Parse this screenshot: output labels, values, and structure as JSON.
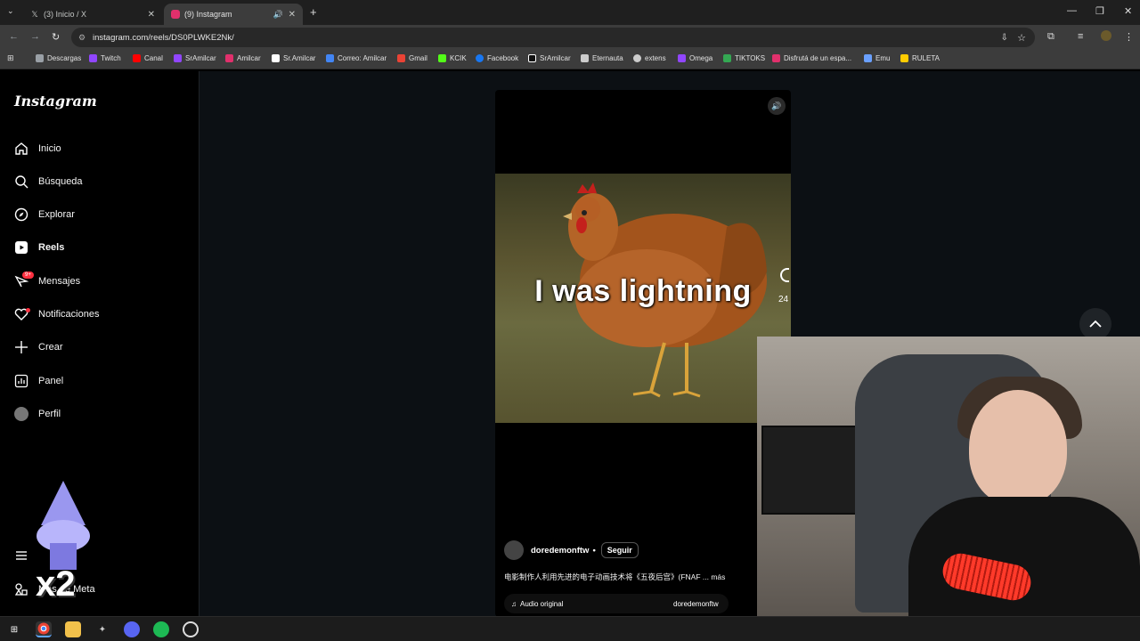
{
  "browser": {
    "tabs": [
      {
        "title": "(3) Inicio / X",
        "active": false,
        "icon": "x-logo-icon"
      },
      {
        "title": "(9) Instagram",
        "active": true,
        "icon": "instagram-icon"
      }
    ],
    "url": "instagram.com/reels/DS0PLWKE2Nk/",
    "bookmarks": [
      {
        "label": "Descargas",
        "icon": "download-icon",
        "color": "#9aa0a6"
      },
      {
        "label": "Twitch",
        "icon": "twitch-icon",
        "color": "#9146ff"
      },
      {
        "label": "Canal",
        "icon": "youtube-icon",
        "color": "#ff0000"
      },
      {
        "label": "SrAmilcar",
        "icon": "twitch-icon",
        "color": "#9146ff"
      },
      {
        "label": "Amilcar",
        "icon": "instagram-icon",
        "color": "#e1306c"
      },
      {
        "label": "Sr.Amilcar",
        "icon": "x-logo-icon",
        "color": "#ffffff"
      },
      {
        "label": "Correo: Amilcar",
        "icon": "mail-icon",
        "color": "#4285f4"
      },
      {
        "label": "Gmail",
        "icon": "gmail-icon",
        "color": "#ea4335"
      },
      {
        "label": "KCIK",
        "icon": "kick-icon",
        "color": "#53fc18"
      },
      {
        "label": "Facebook",
        "icon": "facebook-icon",
        "color": "#1877f2"
      },
      {
        "label": "SrAmilcar",
        "icon": "tiktok-icon",
        "color": "#ffffff"
      },
      {
        "label": "Eternauta",
        "icon": "doc-icon",
        "color": "#cccccc"
      },
      {
        "label": "extens",
        "icon": "puzzle-icon",
        "color": "#cccccc"
      },
      {
        "label": "Omega",
        "icon": "twitch-icon",
        "color": "#9146ff"
      },
      {
        "label": "TIKTOKS",
        "icon": "drive-icon",
        "color": "#34a853"
      },
      {
        "label": "Disfrutá de un espa...",
        "icon": "link-icon",
        "color": "#e1306c"
      },
      {
        "label": "Emu",
        "icon": "emu-icon",
        "color": "#6aa0ff"
      },
      {
        "label": "RULETA",
        "icon": "ruleta-icon",
        "color": "#ffcc00"
      }
    ]
  },
  "instagram": {
    "logo": "Instagram",
    "nav": [
      {
        "label": "Inicio",
        "icon": "home-icon"
      },
      {
        "label": "Búsqueda",
        "icon": "search-icon"
      },
      {
        "label": "Explorar",
        "icon": "compass-icon"
      },
      {
        "label": "Reels",
        "icon": "reels-icon"
      },
      {
        "label": "Mensajes",
        "icon": "messenger-icon",
        "badge": "9+"
      },
      {
        "label": "Notificaciones",
        "icon": "heart-icon"
      },
      {
        "label": "Crear",
        "icon": "plus-icon"
      },
      {
        "label": "Panel",
        "icon": "chart-icon"
      },
      {
        "label": "Perfil",
        "icon": "avatar-icon"
      }
    ],
    "more_meta": "Más de Meta",
    "reel": {
      "overlay_text": "I was lightning",
      "author": "doredemonftw",
      "follow_label": "Seguir",
      "description": "电影制作人利用先进的电子动画技术将《五夜后宫》(FNAF ... más",
      "audio_label": "Audio original",
      "audio_owner": "doredemonftw",
      "side_count": "24"
    }
  },
  "overlay": {
    "multiplier": "x2"
  }
}
